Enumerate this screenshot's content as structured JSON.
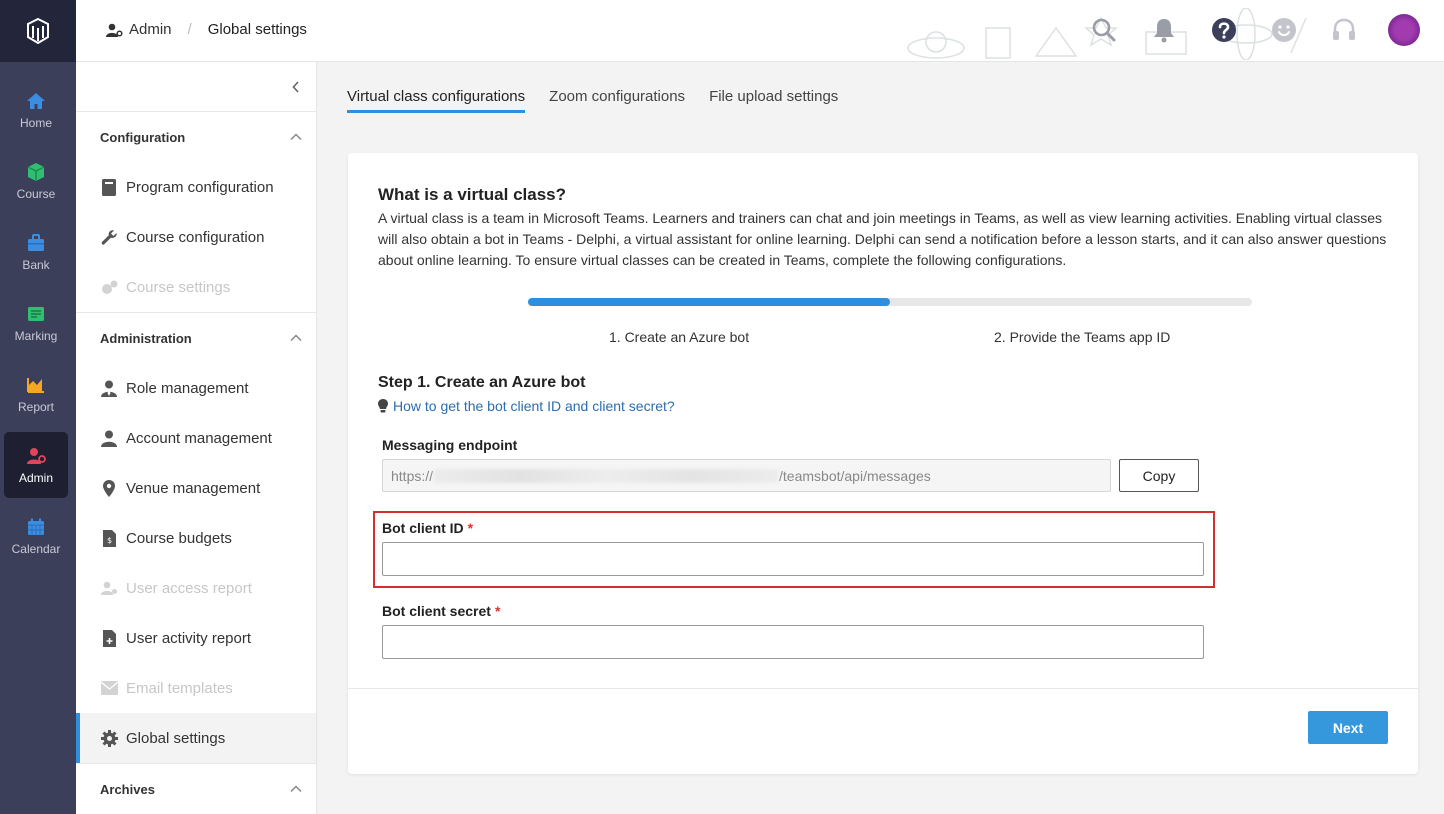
{
  "rail": {
    "items": [
      {
        "label": "Home",
        "icon": "home-icon",
        "color": "#3a8de0"
      },
      {
        "label": "Course",
        "icon": "course-icon",
        "color": "#2fbf71"
      },
      {
        "label": "Bank",
        "icon": "bank-icon",
        "color": "#3a8de0"
      },
      {
        "label": "Marking",
        "icon": "marking-icon",
        "color": "#2fbf71"
      },
      {
        "label": "Report",
        "icon": "report-icon",
        "color": "#f5a623"
      },
      {
        "label": "Admin",
        "icon": "admin-icon",
        "color": "#e0455a",
        "active": true
      },
      {
        "label": "Calendar",
        "icon": "calendar-icon",
        "color": "#3a8de0"
      }
    ]
  },
  "breadcrumb": {
    "root": "Admin",
    "current": "Global settings"
  },
  "sidenav": {
    "sections": [
      {
        "title": "Configuration",
        "items": [
          "Program configuration",
          "Course configuration",
          "Course settings"
        ]
      },
      {
        "title": "Administration",
        "items": [
          "Role management",
          "Account management",
          "Venue management",
          "Course budgets",
          "User access report",
          "User activity report",
          "Email templates",
          "Global settings"
        ]
      },
      {
        "title": "Archives"
      }
    ]
  },
  "tabs": [
    "Virtual class configurations",
    "Zoom configurations",
    "File upload settings"
  ],
  "content": {
    "heading": "What is a virtual class?",
    "description": "A virtual class is a team in Microsoft Teams. Learners and trainers can chat and join meetings in Teams, as well as view learning activities. Enabling virtual classes will also obtain a bot in Teams - Delphi, a virtual assistant for online learning. Delphi can send a notification before a lesson starts, and it can also answer questions about online learning. To ensure virtual classes can be created in Teams, complete the following configurations.",
    "progress": 0.5,
    "steps": [
      "1. Create an Azure bot",
      "2. Provide the Teams app ID"
    ],
    "step_heading": "Step 1. Create an Azure bot",
    "help_link": "How to get the bot client ID and client secret?",
    "endpoint_label": "Messaging endpoint",
    "endpoint_prefix": "https://",
    "endpoint_suffix": "/teamsbot/api/messages",
    "copy_label": "Copy",
    "client_id_label": "Bot client ID",
    "client_secret_label": "Bot client secret",
    "required_mark": "*",
    "next_label": "Next"
  }
}
